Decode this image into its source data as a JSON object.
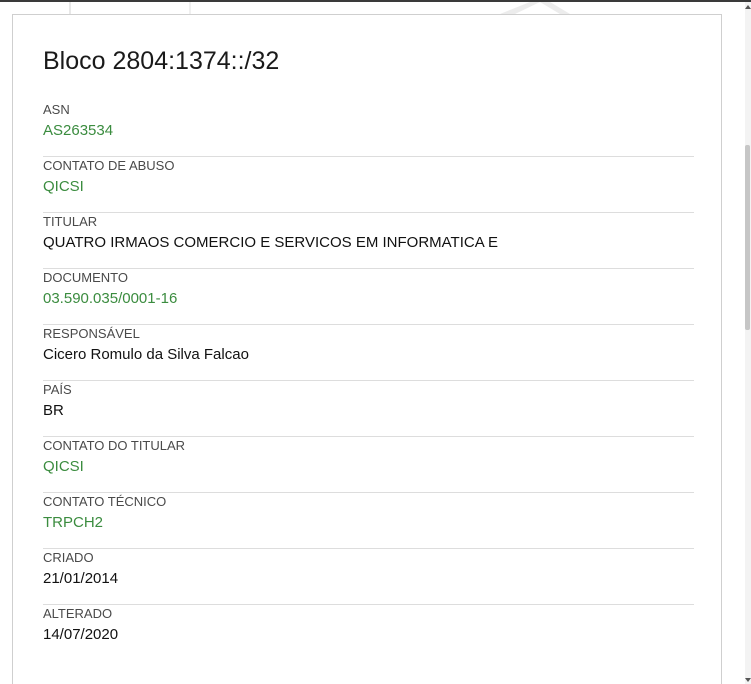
{
  "block": {
    "title": "Bloco 2804:1374::/32",
    "fields": [
      {
        "label": "ASN",
        "value": "AS263534",
        "link": true
      },
      {
        "label": "CONTATO DE ABUSO",
        "value": "QICSI",
        "link": true
      },
      {
        "label": "TITULAR",
        "value": "QUATRO IRMAOS COMERCIO E SERVICOS EM INFORMATICA E",
        "link": false
      },
      {
        "label": "DOCUMENTO",
        "value": "03.590.035/0001-16",
        "link": true
      },
      {
        "label": "RESPONSÁVEL",
        "value": "Cicero Romulo da Silva Falcao",
        "link": false
      },
      {
        "label": "PAÍS",
        "value": "BR",
        "link": false
      },
      {
        "label": "CONTATO DO TITULAR",
        "value": "QICSI",
        "link": true
      },
      {
        "label": "CONTATO TÉCNICO",
        "value": "TRPCH2",
        "link": true
      },
      {
        "label": "CRIADO",
        "value": "21/01/2014",
        "link": false
      },
      {
        "label": "ALTERADO",
        "value": "14/07/2020",
        "link": false
      }
    ]
  },
  "colors": {
    "link": "#3b8c3f",
    "text": "#111111",
    "label": "#4a4a4a",
    "divider": "#dddddd"
  }
}
